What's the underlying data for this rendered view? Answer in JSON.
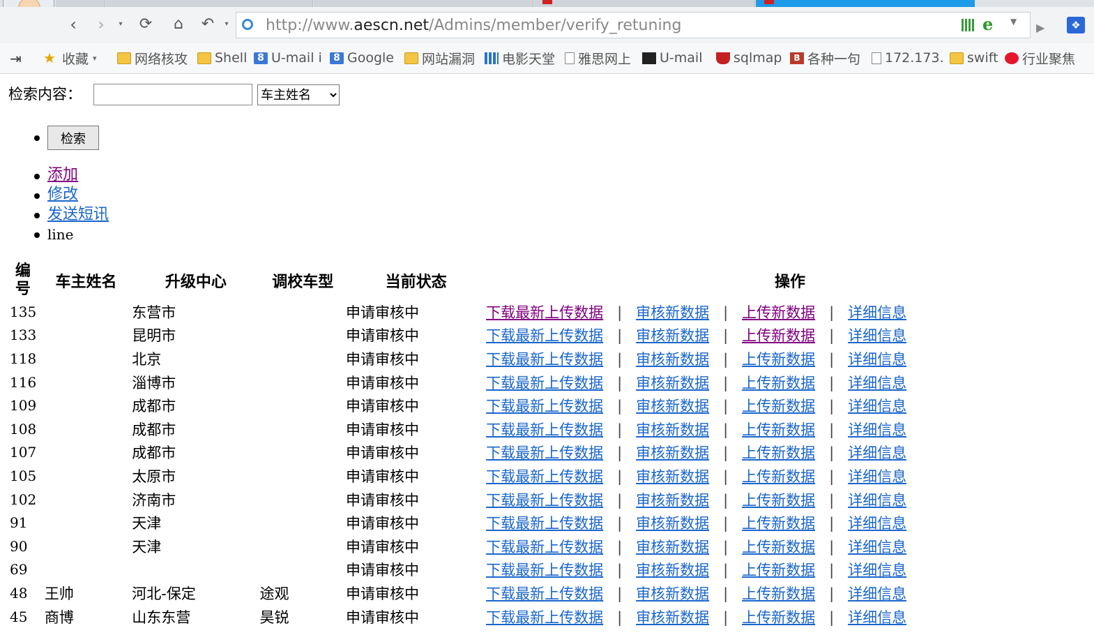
{
  "browser": {
    "url_prefix": "http://www.",
    "url_domain": "aescn.net",
    "url_path": "/Admins/member/verify_retuning",
    "bookmarks": [
      {
        "label": "收藏",
        "icon": "star-icon",
        "caret": true
      },
      {
        "label": "网络核攻",
        "icon": "folder-icon"
      },
      {
        "label": "Shell",
        "icon": "folder-icon"
      },
      {
        "label": "U-mail i",
        "icon": "g8-icon"
      },
      {
        "label": "Google",
        "icon": "g8-icon"
      },
      {
        "label": "网站漏洞",
        "icon": "folder-icon"
      },
      {
        "label": "电影天堂",
        "icon": "grid-icon"
      },
      {
        "label": "雅思网上",
        "icon": "page-icon"
      },
      {
        "label": "U-mail",
        "icon": "dark-icon"
      },
      {
        "label": "sqlmap",
        "icon": "shield-icon"
      },
      {
        "label": "各种一句",
        "icon": "b3-icon"
      },
      {
        "label": "172.173.",
        "icon": "page-icon"
      },
      {
        "label": "swift",
        "icon": "folder-icon"
      },
      {
        "label": "行业聚焦",
        "icon": "weibo-icon"
      }
    ]
  },
  "search": {
    "label": "检索内容：",
    "input_value": "",
    "select_value": "车主姓名",
    "button_label": "检索"
  },
  "menu": {
    "add": "添加",
    "edit": "修改",
    "sms": "发送短讯",
    "line": "line"
  },
  "table": {
    "headers": [
      "编号",
      "车主姓名",
      "升级中心",
      "调校车型",
      "当前状态",
      "操作"
    ],
    "op_labels": {
      "download": "下载最新上传数据",
      "review": "审核新数据",
      "upload": "上传新数据",
      "detail": "详细信息",
      "separator": "|"
    },
    "rows": [
      {
        "id": "135",
        "owner": "",
        "center": "东营市",
        "model": "",
        "status": "申请审核中"
      },
      {
        "id": "133",
        "owner": "",
        "center": "昆明市",
        "model": "",
        "status": "申请审核中"
      },
      {
        "id": "118",
        "owner": "",
        "center": "北京",
        "model": "",
        "status": "申请审核中"
      },
      {
        "id": "116",
        "owner": "",
        "center": "淄博市",
        "model": "",
        "status": "申请审核中"
      },
      {
        "id": "109",
        "owner": "",
        "center": "成都市",
        "model": "",
        "status": "申请审核中"
      },
      {
        "id": "108",
        "owner": "",
        "center": "成都市",
        "model": "",
        "status": "申请审核中"
      },
      {
        "id": "107",
        "owner": "",
        "center": "成都市",
        "model": "",
        "status": "申请审核中"
      },
      {
        "id": "105",
        "owner": "",
        "center": "太原市",
        "model": "",
        "status": "申请审核中"
      },
      {
        "id": "102",
        "owner": "",
        "center": "济南市",
        "model": "",
        "status": "申请审核中"
      },
      {
        "id": "91",
        "owner": "",
        "center": "天津",
        "model": "",
        "status": "申请审核中"
      },
      {
        "id": "90",
        "owner": "",
        "center": "天津",
        "model": "",
        "status": "申请审核中"
      },
      {
        "id": "69",
        "owner": "",
        "center": "",
        "model": "",
        "status": "申请审核中"
      },
      {
        "id": "48",
        "owner": "王帅",
        "center": "河北-保定",
        "model": "途观",
        "status": "申请审核中"
      },
      {
        "id": "45",
        "owner": "商博",
        "center": "山东东营",
        "model": "昊锐",
        "status": "申请审核中"
      }
    ]
  },
  "colors": {
    "link": "#1a66cc",
    "visited": "#800080",
    "active_tab": "#1e9be8"
  }
}
